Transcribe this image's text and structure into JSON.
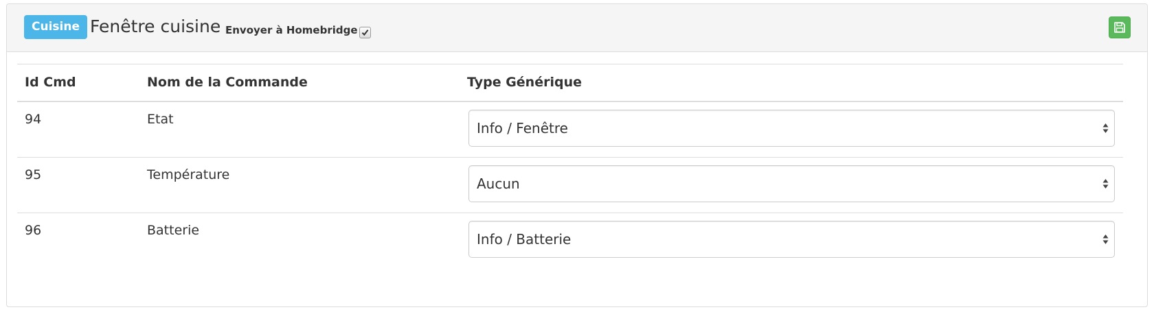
{
  "header": {
    "room_badge": "Cuisine",
    "equipment_name": "Fenêtre cuisine",
    "send_label": "Envoyer à Homebridge",
    "send_checked": true,
    "save_icon": "floppy-disk-icon"
  },
  "table": {
    "columns": [
      "Id Cmd",
      "Nom de la Commande",
      "Type Générique"
    ],
    "rows": [
      {
        "id": "94",
        "name": "Etat",
        "type": "Info / Fenêtre"
      },
      {
        "id": "95",
        "name": "Température",
        "type": "Aucun"
      },
      {
        "id": "96",
        "name": "Batterie",
        "type": "Info / Batterie"
      }
    ]
  },
  "colors": {
    "badge": "#4db6e8",
    "save_button": "#5cb85c",
    "heading_bg": "#f5f5f5"
  }
}
